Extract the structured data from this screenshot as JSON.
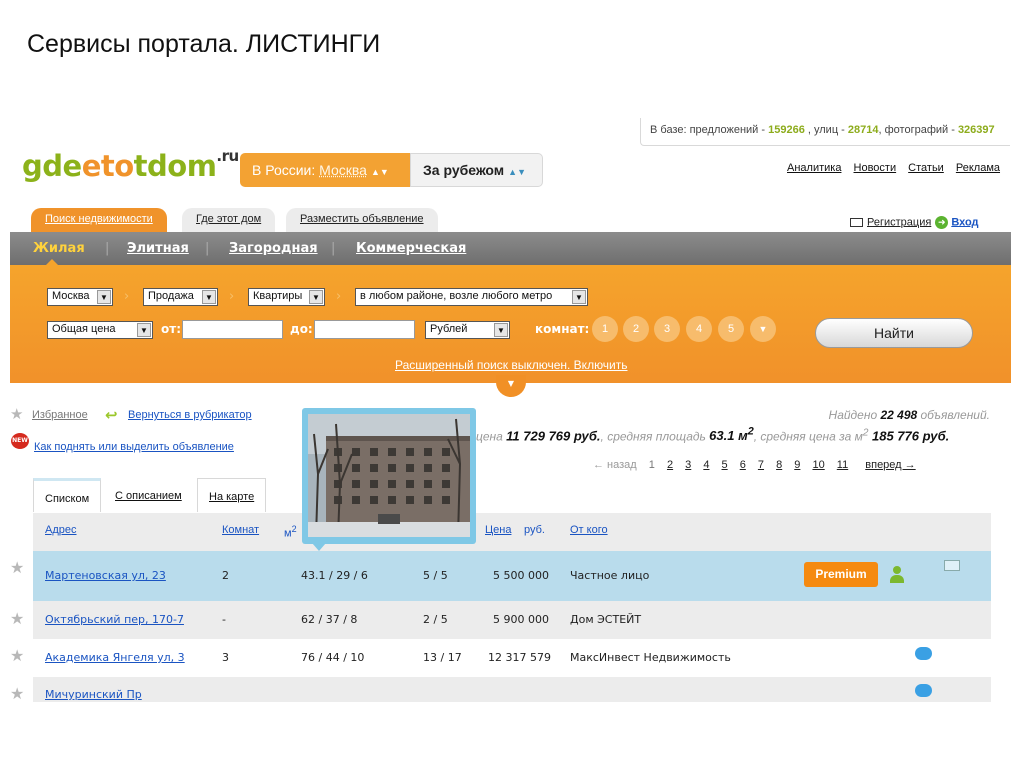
{
  "slide_title": "Сервисы портала. ЛИСТИНГИ",
  "stats": {
    "prefix": "В базе: предложений - ",
    "offers": "159266",
    "streets_label": " , улиц - ",
    "streets": "28714",
    "photos_label": ", фотографий - ",
    "photos": "326397"
  },
  "logo": {
    "part1": "gde",
    "part2": "eto",
    "part3": "tdom",
    "suffix": ".ru"
  },
  "location": {
    "label": "В России",
    "city": "Москва",
    "abroad": "За рубежом"
  },
  "top_links": [
    "Аналитика",
    "Новости",
    "Статьи",
    "Реклама"
  ],
  "main_tabs": [
    "Поиск недвижимости",
    "Где этот дом",
    "Разместить объявление"
  ],
  "auth": {
    "register": "Регистрация",
    "login": "Вход"
  },
  "categories": [
    "Жилая",
    "Элитная",
    "Загородная",
    "Коммерческая"
  ],
  "search": {
    "city": "Москва",
    "deal": "Продажа",
    "type": "Квартиры",
    "area": "в любом районе, возле любого метро",
    "price_type": "Общая цена",
    "from_label": "от:",
    "to_label": "до:",
    "currency": "Рублей",
    "rooms_label": "комнат:",
    "rooms": [
      "1",
      "2",
      "3",
      "4",
      "5"
    ],
    "find": "Найти",
    "advanced": "Расширенный поиск выключен. Включить"
  },
  "sidebar_links": {
    "favorites": "Избранное",
    "back": "Вернуться в рубрикатор",
    "promote": "Как поднять или выделить объявление"
  },
  "found": {
    "prefix": "Найдено ",
    "count": "22 498",
    "suffix": " объявлений."
  },
  "averages": {
    "price_prefix": "цена ",
    "price": "11 729 769 руб.",
    "area_prefix": ", средняя площадь ",
    "area": "63.1 м",
    "area_sup": "2",
    "ppm_prefix": ", средняя цена за м",
    "ppm_sup": "2",
    "ppm": " 185 776 руб."
  },
  "pager": {
    "back": "← назад",
    "current": "1",
    "pages": [
      "2",
      "3",
      "4",
      "5",
      "6",
      "7",
      "8",
      "9",
      "10",
      "11"
    ],
    "next": "вперед →"
  },
  "view_tabs": [
    "Списком",
    "С описанием",
    "На карте"
  ],
  "table_headers": {
    "address": "Адрес",
    "rooms": "Комнат",
    "area": "м",
    "area_sup": "2",
    "price": "Цена",
    "price_unit": "руб.",
    "from": "От кого"
  },
  "rows": [
    {
      "address": "Мартеновская ул, 23",
      "rooms": "2",
      "area": "43.1 / 29 / 6",
      "floor": "5 / 5",
      "price": "5 500 000",
      "from": "Частное лицо",
      "badge": "Premium"
    },
    {
      "address": "Октябрьский пер, 170-7",
      "rooms": "-",
      "area": "62 / 37 / 8",
      "floor": "2 / 5",
      "price": "5 900 000",
      "from": "Дом ЭСТЕЙТ"
    },
    {
      "address": "Академика Янгеля ул, 3",
      "rooms": "3",
      "area": "76 / 44 / 10",
      "floor": "13 / 17",
      "price": "12 317 579",
      "from": "МаксИнвест Недвижимость"
    },
    {
      "address": "Мичуринский Пр",
      "rooms": "",
      "area": "",
      "floor": "",
      "price": "",
      "from": ""
    }
  ],
  "colors": {
    "orange": "#f0932b",
    "green": "#8cb21a",
    "link": "#1a54c2",
    "highlight": "#b9dcec"
  }
}
